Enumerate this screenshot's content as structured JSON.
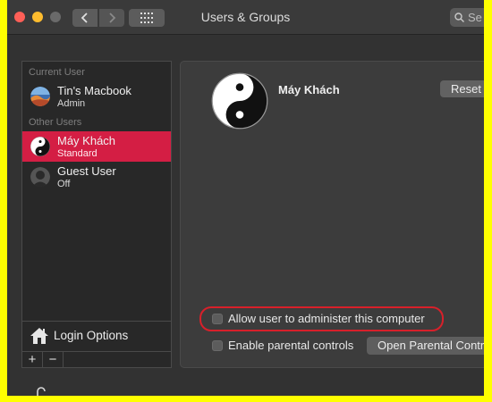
{
  "window": {
    "title": "Users & Groups",
    "search_placeholder": "Se"
  },
  "sidebar": {
    "current_user_label": "Current User",
    "other_users_label": "Other Users",
    "users": [
      {
        "name": "Tin's Macbook",
        "role": "Admin",
        "avatar": "macos-wallpaper-avatar",
        "selected": false
      },
      {
        "name": "Máy Khách",
        "role": "Standard",
        "avatar": "yin-yang-avatar",
        "selected": true
      },
      {
        "name": "Guest User",
        "role": "Off",
        "avatar": "guest-silhouette-avatar",
        "selected": false
      }
    ],
    "login_options_label": "Login Options",
    "add_label": "+",
    "remove_label": "−"
  },
  "detail": {
    "account_name": "Máy Khách",
    "reset_label": "Reset",
    "allow_admin_label": "Allow user to administer this computer",
    "allow_admin_checked": false,
    "parental_label": "Enable parental controls",
    "parental_checked": false,
    "open_parental_label": "Open Parental Controls"
  },
  "colors": {
    "selection": "#d41e44",
    "highlight_outline": "#d8202a",
    "page_border": "#ffff00"
  }
}
